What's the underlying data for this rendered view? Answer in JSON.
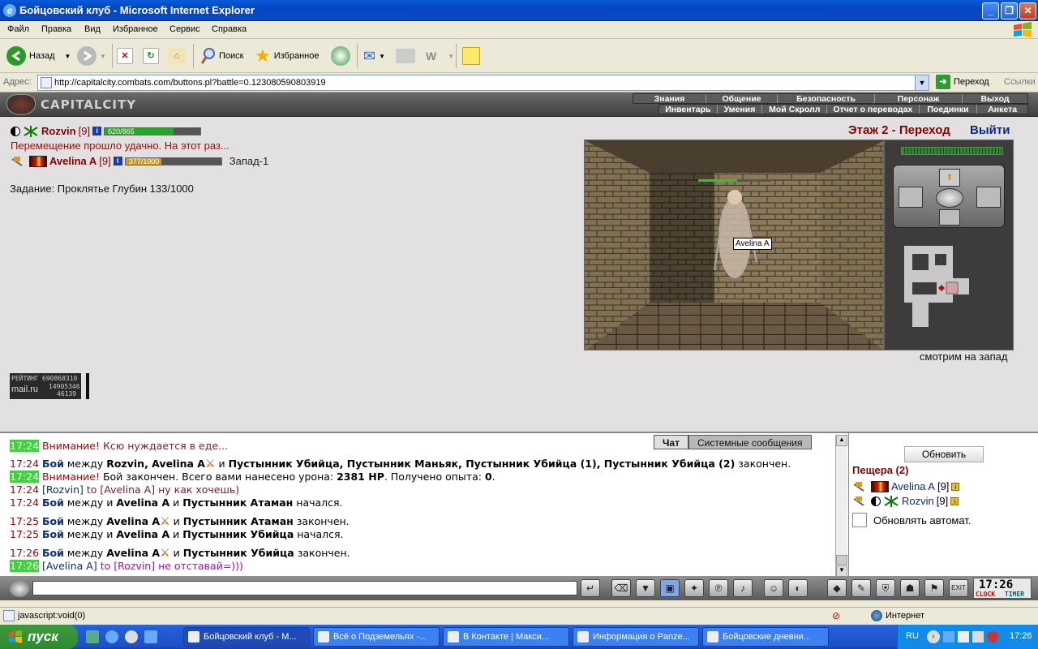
{
  "window": {
    "title": "Бойцовский клуб - Microsoft Internet Explorer"
  },
  "menu": [
    "Файл",
    "Правка",
    "Вид",
    "Избранное",
    "Сервис",
    "Справка"
  ],
  "toolbar": {
    "back": "Назад",
    "search": "Поиск",
    "favorites": "Избранное"
  },
  "address": {
    "label": "Адрес:",
    "url": "http://capitalcity.combats.com/buttons.pl?battle=0.123080590803919",
    "go": "Переход",
    "links": "Ссылки"
  },
  "game": {
    "logo": "CAPITALCITY",
    "topmenu": [
      "Знания",
      "Общение",
      "Безопасность",
      "Персонаж",
      "Выход"
    ],
    "submenu": [
      "Инвентарь",
      "Умения",
      "Мой Скролл",
      "Отчет о переводах",
      "Поединки",
      "Анкета"
    ],
    "player1": {
      "name": "Rozvin",
      "level": "[9]",
      "hp": "620/865",
      "hp_fraction": 0.72
    },
    "move_msg": "Перемещение прошло удачно. На этот раз...",
    "player2": {
      "name": "Avelina A",
      "level": "[9]",
      "hp": "377/1000",
      "hp_fraction": 0.377,
      "direction": "Запад-1"
    },
    "quest": "Задание: Проклятье Глубин 133/1000",
    "floor": "Этаж 2 - Переход",
    "exit": "Выйти",
    "scene_label": "Avelina A",
    "looking": "смотрим на запад",
    "rating": {
      "l1": "РЕЙТИНГ",
      "v1": "690868310",
      "l2": "mail.ru",
      "v2": "14905346",
      "v3": "46139"
    }
  },
  "chat": {
    "tabs": [
      "Чат",
      "Системные сообщения"
    ],
    "lines": {
      "l0": {
        "time": "17:24",
        "a": "Внимание!",
        "b": " Ксю нуждается в еде..."
      },
      "l1": {
        "time": "17:24",
        "boi": "Бой",
        "t1": " между ",
        "p1": "Rozvin, Avelina A",
        "t2": " и ",
        "p2": "Пустынник Убийца, Пустынник Маньяк, Пустынник Убийца (1), Пустынник Убийца (2)",
        "t3": " закончен."
      },
      "l2": {
        "time": "17:24",
        "a": "Внимание!",
        "b": " Бой закончен. Всего вами нанесено урона: ",
        "dmg": "2381 HP",
        "c": ". Получено опыта: ",
        "exp": "0",
        "d": "."
      },
      "l3": {
        "time": "17:24",
        "from": "[Rozvin]",
        "to": " to [Avelina A]",
        "msg": " ну как хочешь)"
      },
      "l4": {
        "time": "17:24",
        "boi": "Бой",
        "t1": " между и ",
        "p1": "Avelina A",
        "t2": " и ",
        "p2": "Пустынник Атаман",
        "t3": " начался."
      },
      "l5": {
        "time": "17:25",
        "boi": "Бой",
        "t1": " между ",
        "p1": "Avelina A",
        "t2": " и ",
        "p2": "Пустынник Атаман",
        "t3": " закончен."
      },
      "l6": {
        "time": "17:25",
        "boi": "Бой",
        "t1": " между и ",
        "p1": "Avelina A",
        "t2": " и ",
        "p2": "Пустынник Убийца",
        "t3": " начался."
      },
      "l7": {
        "time": "17:26",
        "boi": "Бой",
        "t1": " между ",
        "p1": "Avelina A",
        "t2": " и ",
        "p2": "Пустынник Убийца",
        "t3": " закончен."
      },
      "l8": {
        "time": "17:26",
        "from": "[Avelina A]",
        "to": " to [Rozvin]",
        "msg": " не отставай=)))"
      }
    }
  },
  "room": {
    "refresh": "Обновить",
    "name": "Пещера (2)",
    "users": [
      {
        "name": "Avelina A",
        "level": "[9]"
      },
      {
        "name": "Rozvin",
        "level": "[9]"
      }
    ],
    "autorefresh": "Обновлять автомат."
  },
  "clock": {
    "time": "17:26",
    "label1": "CLOCK",
    "label2": "TIMER"
  },
  "status": {
    "text": "javascript:void(0)",
    "zone": "Интернет"
  },
  "taskbar": {
    "start": "пуск",
    "tasks": [
      "Бойцовский клуб - М...",
      "Всё о Подземельях -...",
      "В Контакте | Макси...",
      "Информация о Panze...",
      "Бойцовские дневни..."
    ],
    "lang": "RU",
    "time": "17:26"
  },
  "colors": {
    "accent_dark_red": "#8a0000",
    "link_blue": "#0a2a8a",
    "time_green_bg": "#40d040"
  }
}
